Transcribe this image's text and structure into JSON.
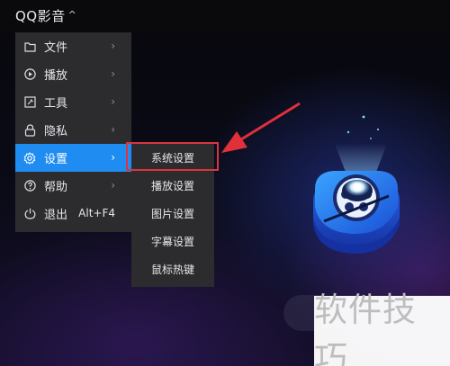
{
  "app": {
    "title": "QQ影音",
    "title_caret": "^"
  },
  "menu": {
    "items": [
      {
        "label": "文件",
        "icon": "folder-icon",
        "arrow": "›"
      },
      {
        "label": "播放",
        "icon": "play-icon",
        "arrow": "›"
      },
      {
        "label": "工具",
        "icon": "tools-icon",
        "arrow": "›"
      },
      {
        "label": "隐私",
        "icon": "lock-icon",
        "arrow": "›"
      },
      {
        "label": "设置",
        "icon": "gear-icon",
        "arrow": "›",
        "active": true
      },
      {
        "label": "帮助",
        "icon": "help-icon",
        "arrow": "›"
      },
      {
        "label": "退出",
        "icon": "power-icon",
        "shortcut": "Alt+F4"
      }
    ]
  },
  "submenu": {
    "items": [
      {
        "label": "系统设置",
        "highlighted": true
      },
      {
        "label": "播放设置"
      },
      {
        "label": "图片设置"
      },
      {
        "label": "字幕设置"
      },
      {
        "label": "鼠标热键"
      }
    ]
  },
  "watermark": {
    "text": "软件技巧"
  },
  "colors": {
    "accent": "#1e8cf0",
    "menu_bg": "#2c2c2f",
    "highlight_border": "#d9363e",
    "arrow_red": "#e0303a"
  }
}
